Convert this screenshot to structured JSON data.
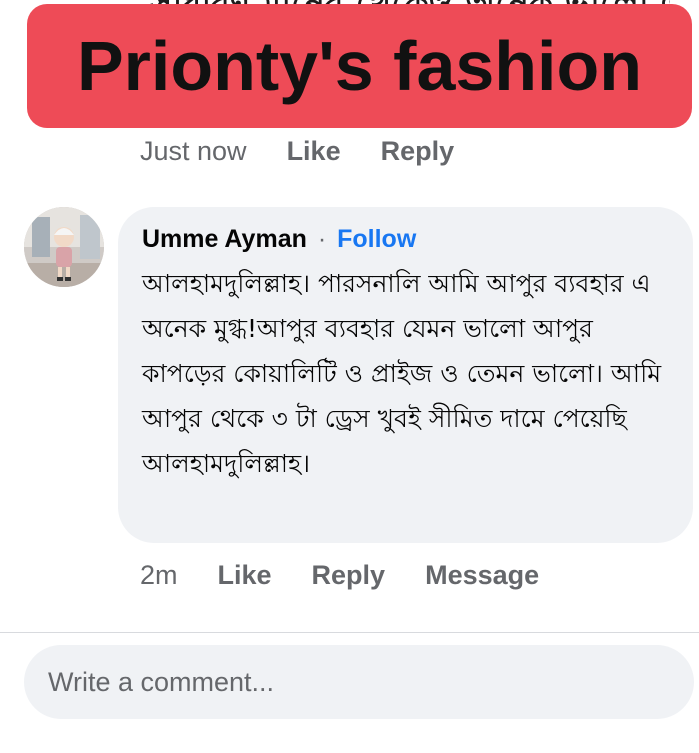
{
  "top_cutoff_text": "সাধারণ মানের থেকেও অনেক ভালো এবং",
  "banner": {
    "title": "Prionty's fashion"
  },
  "previous_comment": {
    "time": "Just now",
    "like_label": "Like",
    "reply_label": "Reply"
  },
  "comment": {
    "author": "Umme Ayman",
    "separator": "·",
    "follow_label": "Follow",
    "text": "আলহামদুলিল্লাহ। পারসনালি আমি আপুর ব্যবহার এ অনেক মুগ্ধ!আপুর ব্যবহার যেমন ভালো আপুর কাপড়ের কোয়ালিটি ও প্রাইজ ও তেমন ভালো। আমি আপুর থেকে ৩ টা ড্রেস খুবই সীমিত দামে পেয়েছি আলহামদুলিল্লাহ।",
    "time": "2m",
    "like_label": "Like",
    "reply_label": "Reply",
    "message_label": "Message"
  },
  "composer": {
    "placeholder": "Write a comment..."
  },
  "colors": {
    "banner_bg": "#ee4b57",
    "bubble_bg": "#f0f2f5",
    "follow_link": "#1877f2",
    "muted_text": "#65676b"
  }
}
